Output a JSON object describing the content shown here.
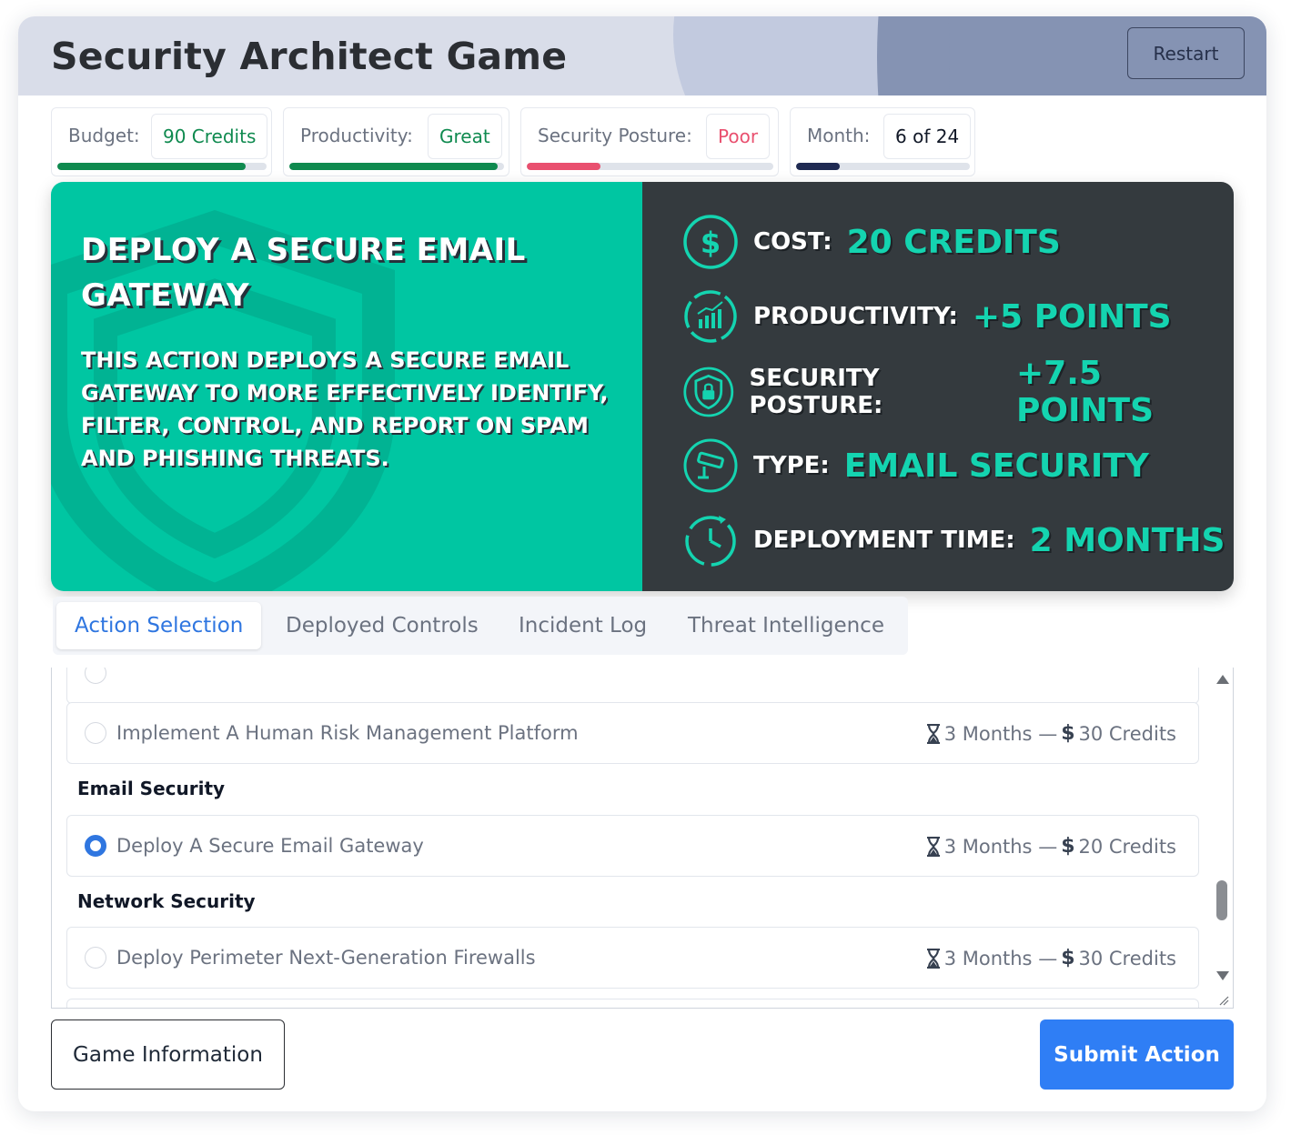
{
  "header": {
    "title": "Security Architect Game",
    "restart_label": "Restart"
  },
  "stats": {
    "budget": {
      "label": "Budget:",
      "value": "90 Credits",
      "fill_fraction": 0.9,
      "color": "#0f8a4f"
    },
    "productivity": {
      "label": "Productivity:",
      "value": "Great",
      "fill_fraction": 0.97,
      "color": "#0f8a4f"
    },
    "security_posture": {
      "label": "Security Posture:",
      "value": "Poor",
      "fill_fraction": 0.3,
      "color": "#e9506f"
    },
    "month": {
      "label": "Month:",
      "value": "6 of 24",
      "fill_fraction": 0.25,
      "color": "#1f2a52"
    }
  },
  "action": {
    "title": "Deploy a Secure Email Gateway",
    "description": "This action deploys a secure email gateway to more effectively identify, filter, control, and report on spam and phishing threats.",
    "cost_label": "Cost:",
    "cost_value": "20 Credits",
    "productivity_label": "Productivity:",
    "productivity_value": "+5 Points",
    "security_label": "Security Posture:",
    "security_value": "+7.5 Points",
    "type_label": "Type:",
    "type_value": "Email Security",
    "time_label": "Deployment Time:",
    "time_value": "2 Months",
    "icons": [
      "dollar-circle-icon",
      "productivity-chart-icon",
      "security-shield-lock-icon",
      "cctv-camera-icon",
      "clock-icon"
    ]
  },
  "tabs": [
    {
      "label": "Action Selection",
      "active": true
    },
    {
      "label": "Deployed Controls",
      "active": false
    },
    {
      "label": "Incident Log",
      "active": false
    },
    {
      "label": "Threat Intelligence",
      "active": false
    }
  ],
  "list": {
    "rows": [
      {
        "name": "Implement A Human Risk Management Platform",
        "months": "3 Months",
        "separator": "—",
        "currency": "$",
        "credits": "30 Credits",
        "selected": false
      },
      {
        "name": "Deploy A Secure Email Gateway",
        "months": "3 Months",
        "separator": "—",
        "currency": "$",
        "credits": "20 Credits",
        "selected": true
      },
      {
        "name": "Deploy Perimeter Next-Generation Firewalls",
        "months": "3 Months",
        "separator": "—",
        "currency": "$",
        "credits": "30 Credits",
        "selected": false
      }
    ],
    "groups": [
      "Email Security",
      "Network Security"
    ]
  },
  "footer": {
    "info_label": "Game Information",
    "submit_label": "Submit Action"
  },
  "colors": {
    "accent": "#2f7ef5",
    "teal": "#00c6a2",
    "dark_panel": "#343a3e"
  }
}
